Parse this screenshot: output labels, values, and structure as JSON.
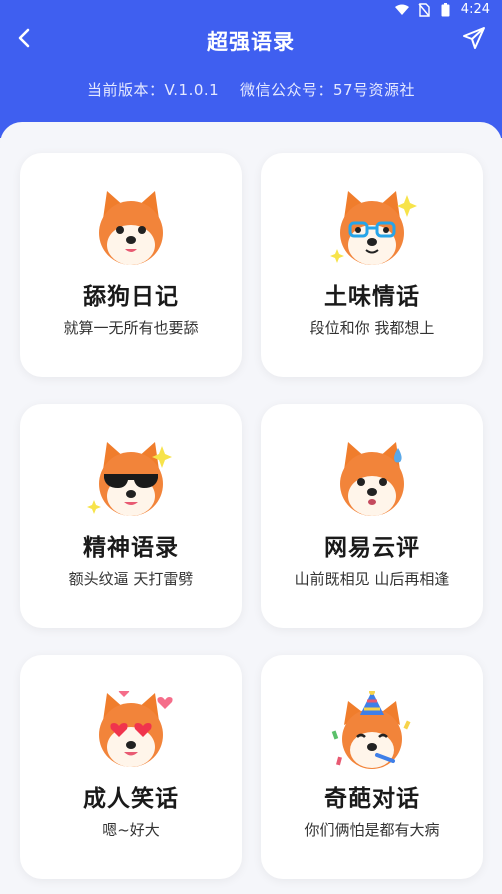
{
  "status_bar": {
    "time": "4:24",
    "icons": [
      "wifi-icon",
      "no-sim-icon",
      "battery-icon"
    ]
  },
  "app_bar": {
    "title": "超强语录",
    "back_icon": "back-icon",
    "share_icon": "share-icon"
  },
  "version_line": "当前版本：V.1.0.1 　微信公众号：57号资源社",
  "cards": [
    {
      "title": "舔狗日记",
      "subtitle": "就算一无所有也要舔",
      "emoji": "shiba-face"
    },
    {
      "title": "土味情话",
      "subtitle": "段位和你 我都想上",
      "emoji": "shiba-glasses"
    },
    {
      "title": "精神语录",
      "subtitle": "额头纹逼 天打雷劈",
      "emoji": "shiba-sunglasses"
    },
    {
      "title": "网易云评",
      "subtitle": "山前既相见 山后再相逢",
      "emoji": "shiba-sweat"
    },
    {
      "title": "成人笑话",
      "subtitle": "嗯~好大",
      "emoji": "shiba-heart-eyes"
    },
    {
      "title": "奇葩对话",
      "subtitle": "你们俩怕是都有大病",
      "emoji": "shiba-party"
    }
  ],
  "colors": {
    "primary": "#3f5ff0",
    "card_bg": "#ffffff",
    "page_bg": "#f5f6fa"
  }
}
